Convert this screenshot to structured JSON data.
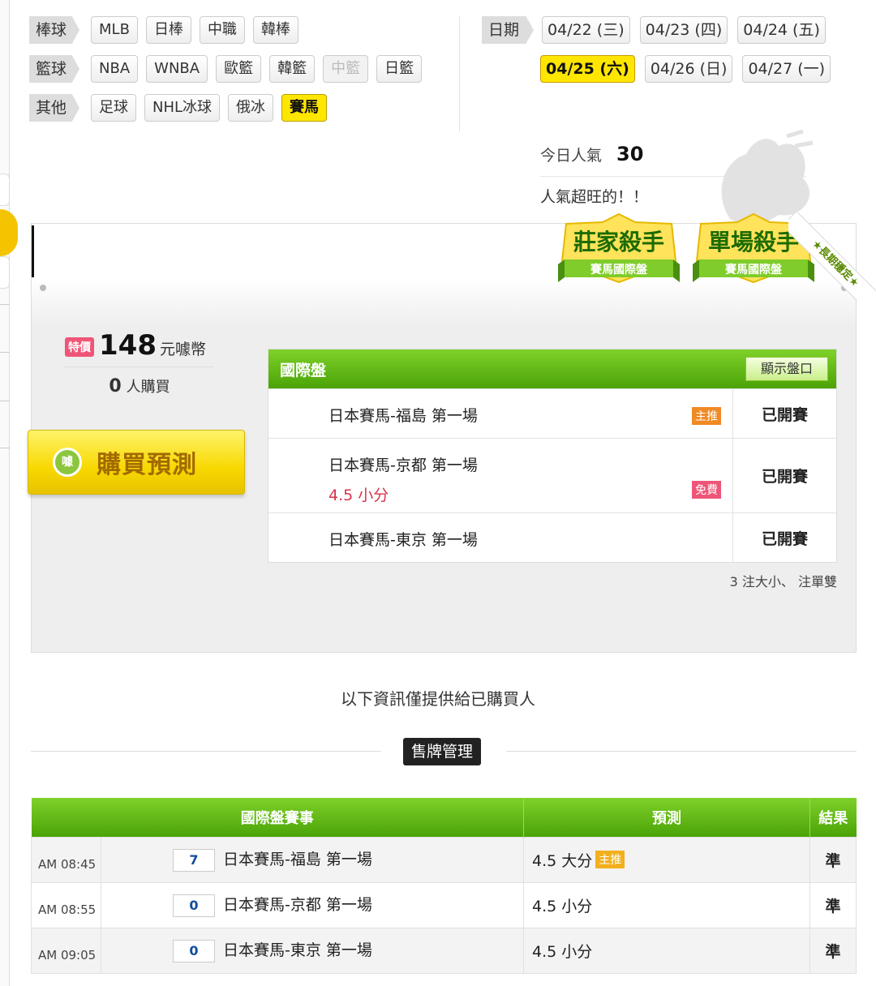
{
  "categories": [
    {
      "label": "棒球",
      "items": [
        {
          "text": "MLB",
          "state": "normal"
        },
        {
          "text": "日棒",
          "state": "normal"
        },
        {
          "text": "中職",
          "state": "normal"
        },
        {
          "text": "韓棒",
          "state": "normal"
        }
      ]
    },
    {
      "label": "籃球",
      "items": [
        {
          "text": "NBA",
          "state": "normal"
        },
        {
          "text": "WNBA",
          "state": "normal"
        },
        {
          "text": "歐籃",
          "state": "normal"
        },
        {
          "text": "韓籃",
          "state": "normal"
        },
        {
          "text": "中籃",
          "state": "disabled"
        },
        {
          "text": "日籃",
          "state": "normal"
        }
      ]
    },
    {
      "label": "其他",
      "items": [
        {
          "text": "足球",
          "state": "normal"
        },
        {
          "text": "NHL冰球",
          "state": "normal"
        },
        {
          "text": "俄冰",
          "state": "normal"
        },
        {
          "text": "賽馬",
          "state": "active"
        }
      ]
    }
  ],
  "dates": {
    "label": "日期",
    "row1": [
      {
        "text": "04/22 (三)",
        "active": false
      },
      {
        "text": "04/23 (四)",
        "active": false
      },
      {
        "text": "04/24 (五)",
        "active": false
      }
    ],
    "row2": [
      {
        "text": "04/25 (六)",
        "active": true
      },
      {
        "text": "04/26 (日)",
        "active": false
      },
      {
        "text": "04/27 (一)",
        "active": false
      }
    ]
  },
  "popularity": {
    "label": "今日人氣",
    "value": "30",
    "message": "人氣超旺的！！"
  },
  "badges": [
    {
      "title": "莊家殺手",
      "sub": "賽馬國際盤"
    },
    {
      "title": "單場殺手",
      "sub": "賽馬國際盤"
    }
  ],
  "ribbon": "★長期穩定★",
  "price": {
    "tag": "特價",
    "value": "148",
    "unit": "元噱幣",
    "buyers_count": "0",
    "buyers_label": "人購買"
  },
  "buy_button": {
    "icon": "噱",
    "label": "購買預測"
  },
  "games": {
    "title": "國際盤",
    "toggle_label": "顯示盤口",
    "rows": [
      {
        "name": "日本賽馬-福島 第一場",
        "sub": "",
        "tag": "主推",
        "tag_color": "#f08a24",
        "status": "已開賽"
      },
      {
        "name": "日本賽馬-京都 第一場",
        "sub": "4.5 小分",
        "tag": "免費",
        "tag_color": "#ee5577",
        "status": "已開賽"
      },
      {
        "name": "日本賽馬-東京 第一場",
        "sub": "",
        "tag": "",
        "tag_color": "",
        "status": "已開賽"
      }
    ],
    "note": "3 注大小、 注單雙"
  },
  "info_text": "以下資訊僅提供給已購買人",
  "mgmt_button": "售牌管理",
  "results": {
    "headers": {
      "game": "國際盤賽事",
      "pred": "預測",
      "result": "結果"
    },
    "rows": [
      {
        "time": "AM 08:45",
        "num": "7",
        "game": "日本賽馬-福島 第一場",
        "pred": "4.5 大分",
        "pred_tag": "主推",
        "result": "準"
      },
      {
        "time": "AM 08:55",
        "num": "0",
        "game": "日本賽馬-京都 第一場",
        "pred": "4.5 小分",
        "pred_tag": "",
        "result": "準"
      },
      {
        "time": "AM 09:05",
        "num": "0",
        "game": "日本賽馬-東京 第一場",
        "pred": "4.5 小分",
        "pred_tag": "",
        "result": "準"
      }
    ]
  },
  "colors": {
    "accent_green": "#4aa307",
    "highlight_yellow": "#ffe600",
    "status_green": "#3a9a00",
    "sub_red": "#d8334a"
  }
}
